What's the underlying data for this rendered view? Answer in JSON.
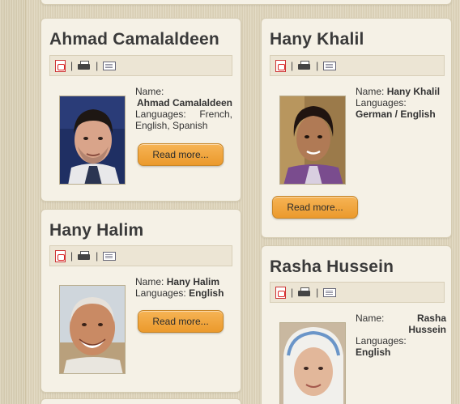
{
  "cards": {
    "ahmad": {
      "name": "Ahmad Camalaldeen",
      "name_label": "Name:",
      "name_value": "Ahmad Camalaldeen",
      "languages_label": "Languages:",
      "languages_value": "French, English, Spanish",
      "read_more": "Read more..."
    },
    "hany_halim": {
      "name": "Hany Halim",
      "name_label": "Name:",
      "name_value": "Hany Halim",
      "languages_label": "Languages:",
      "languages_value": "English",
      "read_more": "Read more..."
    },
    "hany_khalil": {
      "name": "Hany Khalil",
      "name_label": "Name:",
      "name_value": "Hany Khalil",
      "languages_label": "Languages:",
      "languages_value": "German / English",
      "read_more": "Read more..."
    },
    "rasha": {
      "name": "Rasha Hussein",
      "name_label": "Name:",
      "name_value": "Rasha Hussein",
      "languages_label": "Languages:",
      "languages_value": "English"
    }
  },
  "icons": [
    "pdf-icon",
    "print-icon",
    "email-icon"
  ],
  "separator": "|",
  "colors": {
    "card_bg": "#f5f1e6",
    "button": "#eb9a2c",
    "heading": "#3a3a3a"
  }
}
